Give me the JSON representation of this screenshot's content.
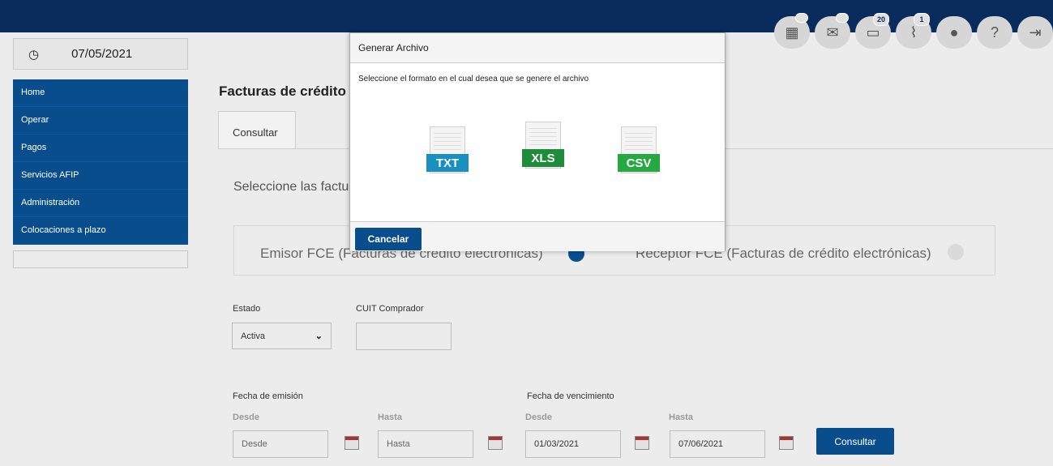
{
  "header": {
    "icons": [
      {
        "name": "calculator-icon",
        "badge": ""
      },
      {
        "name": "mail-icon",
        "badge": ""
      },
      {
        "name": "folder-icon",
        "badge": "20"
      },
      {
        "name": "attachment-icon",
        "badge": "1"
      },
      {
        "name": "user-icon",
        "badge": ""
      },
      {
        "name": "help-icon",
        "badge": ""
      },
      {
        "name": "logout-icon",
        "badge": ""
      }
    ]
  },
  "sidebar": {
    "date": "07/05/2021",
    "items": [
      {
        "label": "Home"
      },
      {
        "label": "Operar"
      },
      {
        "label": "Pagos"
      },
      {
        "label": "Servicios AFIP"
      },
      {
        "label": "Administración"
      },
      {
        "label": "Colocaciones a plazo"
      }
    ]
  },
  "main": {
    "title": "Facturas de crédito",
    "tab": "Consultar",
    "select_text": "Seleccione las factura",
    "radio_emisor": "Emisor FCE (Facturas de crédito electrónicas)",
    "radio_receptor": "Receptor FCE (Facturas de crédito electrónicas)",
    "estado_label": "Estado",
    "estado_value": "Activa",
    "cuit_label": "CUIT Comprador",
    "cuit_value": "",
    "fecha_emision_label": "Fecha de emisión",
    "fecha_venc_label": "Fecha de vencimiento",
    "desde_label": "Desde",
    "hasta_label": "Hasta",
    "emision_desde_placeholder": "Desde",
    "emision_hasta_placeholder": "Hasta",
    "venc_desde_value": "01/03/2021",
    "venc_hasta_value": "07/06/2021",
    "consultar_button": "Consultar"
  },
  "modal": {
    "title": "Generar Archivo",
    "description": "Seleccione el formato en el cual desea que se genere el archivo",
    "formats": [
      {
        "label": "TXT",
        "color": "#1b8fc0"
      },
      {
        "label": "XLS",
        "color": "#1e8c3a"
      },
      {
        "label": "CSV",
        "color": "#27a841"
      }
    ],
    "cancel_button": "Cancelar"
  },
  "colors": {
    "topbar": "#0a2c5c",
    "nav": "#0a4d8c",
    "primary_button": "#0a4d8c"
  }
}
